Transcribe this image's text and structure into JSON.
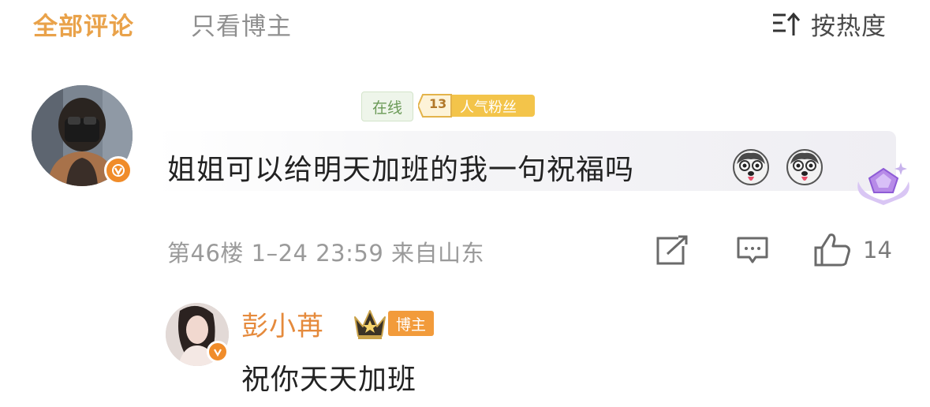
{
  "tabs": {
    "all_comments": "全部评论",
    "blogger_only": "只看博主"
  },
  "sort": {
    "label": "按热度",
    "icon": "sort-icon"
  },
  "comment": {
    "avatar": "avatar",
    "verified_icon": "verified-v-icon",
    "online_badge": "在线",
    "fan_badge": {
      "level": "13",
      "label": "人气粉丝"
    },
    "text": "姐姐可以给明天加班的我一句祝福吗",
    "emojis": [
      "husky-emoji",
      "husky-emoji"
    ],
    "decoration": "gem-icon",
    "meta": "第46楼 1–24 23:59 来自山东",
    "like_count": "14"
  },
  "reply": {
    "avatar": "avatar",
    "name": "彭小苒",
    "blogger_badge": "博主",
    "text": "祝你天天加班"
  },
  "colors": {
    "accent": "#e9a24a",
    "reply_name": "#e58a3c",
    "blogger_badge": "#f29b3b",
    "verified": "#f08c2a",
    "online_text": "#6b9a57"
  }
}
